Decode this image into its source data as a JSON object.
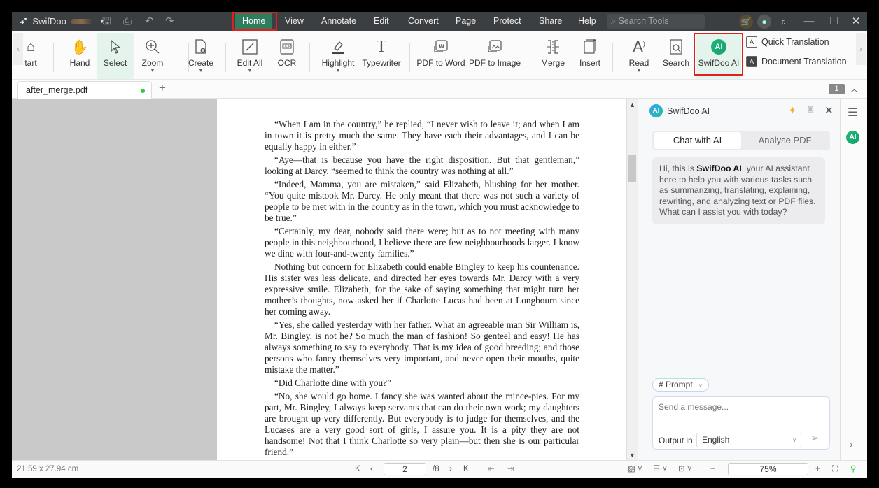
{
  "titlebar": {
    "app_name": "SwifDoo",
    "menu_tabs": [
      "Home",
      "View",
      "Annotate",
      "Edit",
      "Convert",
      "Page",
      "Protect",
      "Share",
      "Help"
    ],
    "active_tab": "Home",
    "search_placeholder": "Search Tools"
  },
  "ribbon": {
    "buttons": [
      {
        "label": "tart",
        "icon": "home-icon"
      },
      {
        "label": "Hand",
        "icon": "hand-icon"
      },
      {
        "label": "Select",
        "icon": "cursor-icon"
      },
      {
        "label": "Zoom",
        "icon": "zoom-icon"
      },
      {
        "label": "Create",
        "icon": "create-icon"
      },
      {
        "label": "Edit All",
        "icon": "edit-icon"
      },
      {
        "label": "OCR",
        "icon": "ocr-icon"
      },
      {
        "label": "Highlight",
        "icon": "highlight-icon"
      },
      {
        "label": "Typewriter",
        "icon": "typewriter-icon"
      },
      {
        "label": "PDF to Word",
        "icon": "pdf-to-word-icon"
      },
      {
        "label": "PDF to Image",
        "icon": "pdf-to-image-icon"
      },
      {
        "label": "Merge",
        "icon": "merge-icon"
      },
      {
        "label": "Insert",
        "icon": "insert-icon"
      },
      {
        "label": "Read",
        "icon": "read-icon"
      },
      {
        "label": "Search",
        "icon": "search-icon"
      },
      {
        "label": "SwifDoo AI",
        "icon": "ai-icon"
      }
    ],
    "quick_translation": "Quick Translation",
    "document_translation": "Document Translation"
  },
  "tabs": {
    "doc_tab": "after_merge.pdf",
    "page_badge": "1"
  },
  "document": {
    "paragraphs": [
      "“When I am in the country,” he replied, “I never wish to leave it; and when I am in town it is pretty much the same. They have each their advantages, and I can be equally happy in either.”",
      "“Aye—that is because you have the right disposition. But that gentleman,” looking at Darcy, “seemed to think the country was nothing at all.”",
      "“Indeed, Mamma, you are mistaken,” said Elizabeth, blushing for her mother. “You quite mistook Mr. Darcy. He only meant that there was not such a variety of people to be met with in the country as in the town, which you must acknowledge to be true.”",
      "“Certainly, my dear, nobody said there were; but as to not meeting with many people in this neighbourhood, I believe there are few neighbourhoods larger. I know we dine with four-and-twenty families.”",
      "Nothing but concern for Elizabeth could enable Bingley to keep his countenance. His sister was less delicate, and directed her eyes towards Mr. Darcy with a very expressive smile. Elizabeth, for the sake of saying something that might turn her mother’s thoughts, now asked her if Charlotte Lucas had been at Longbourn since her coming away.",
      "“Yes, she called yesterday with her father. What an agreeable man Sir William is, Mr. Bingley, is not he? So much the man of fashion! So genteel and easy! He has always something to say to everybody. That is my idea of good breeding; and those persons who fancy themselves very important, and never open their mouths, quite mistake the matter.”",
      "“Did Charlotte dine with you?”",
      "“No, she would go home. I fancy she was wanted about the mince-pies. For my part, Mr. Bingley, I always keep servants that can do their own work; my daughters are brought up very differently. But everybody is to judge for themselves, and the Lucases are a very good sort of girls, I assure you. It is a pity they are not handsome! Not that I think Charlotte so very plain—but then she is our particular friend.”"
    ]
  },
  "ai_panel": {
    "title": "SwifDoo AI",
    "tabs": [
      "Chat with AI",
      "Analyse PDF"
    ],
    "active_tab": "Chat with AI",
    "greeting_prefix": "Hi, this is ",
    "greeting_bold": "SwifDoo AI",
    "greeting_suffix": ", your AI assistant here to help you with various tasks such as summarizing, translating, explaining, rewriting, and analyzing text or PDF files. What can I assist you with today?",
    "prompt_label": "# Prompt",
    "message_placeholder": "Send a message...",
    "output_label": "Output in",
    "output_language": "English"
  },
  "status": {
    "page_size": "21.59 x 27.94 cm",
    "current_page": "2",
    "total_pages": "/8",
    "zoom": "75%"
  },
  "colors": {
    "active_tab": "#2e7d5e",
    "highlight_box": "#e02020",
    "select_bg": "#e4f4ec",
    "ai_green": "#20c0a0"
  }
}
